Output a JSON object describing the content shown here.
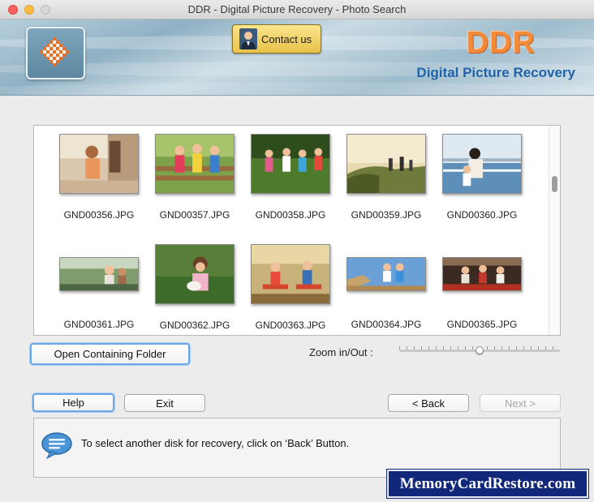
{
  "window": {
    "title": "DDR - Digital Picture Recovery - Photo Search"
  },
  "header": {
    "contact_label": "Contact us",
    "brand_title": "DDR",
    "brand_subtitle": "Digital Picture Recovery",
    "brand_title_color": "#f38a3a",
    "brand_subtitle_color": "#1f63a8"
  },
  "gallery": {
    "items": [
      {
        "name": "GND00356.JPG"
      },
      {
        "name": "GND00357.JPG"
      },
      {
        "name": "GND00358.JPG"
      },
      {
        "name": "GND00359.JPG"
      },
      {
        "name": "GND00360.JPG"
      },
      {
        "name": "GND00361.JPG"
      },
      {
        "name": "GND00362.JPG"
      },
      {
        "name": "GND00363.JPG"
      },
      {
        "name": "GND00364.JPG"
      },
      {
        "name": "GND00365.JPG"
      }
    ]
  },
  "actions": {
    "open_folder_label": "Open Containing Folder",
    "zoom_label": "Zoom in/Out :",
    "help_label": "Help",
    "exit_label": "Exit",
    "back_label": "< Back",
    "next_label": "Next >"
  },
  "info": {
    "message": "To select another disk for recovery, click on ‘Back’ Button."
  },
  "watermark": {
    "text": "MemoryCardRestore.com"
  }
}
